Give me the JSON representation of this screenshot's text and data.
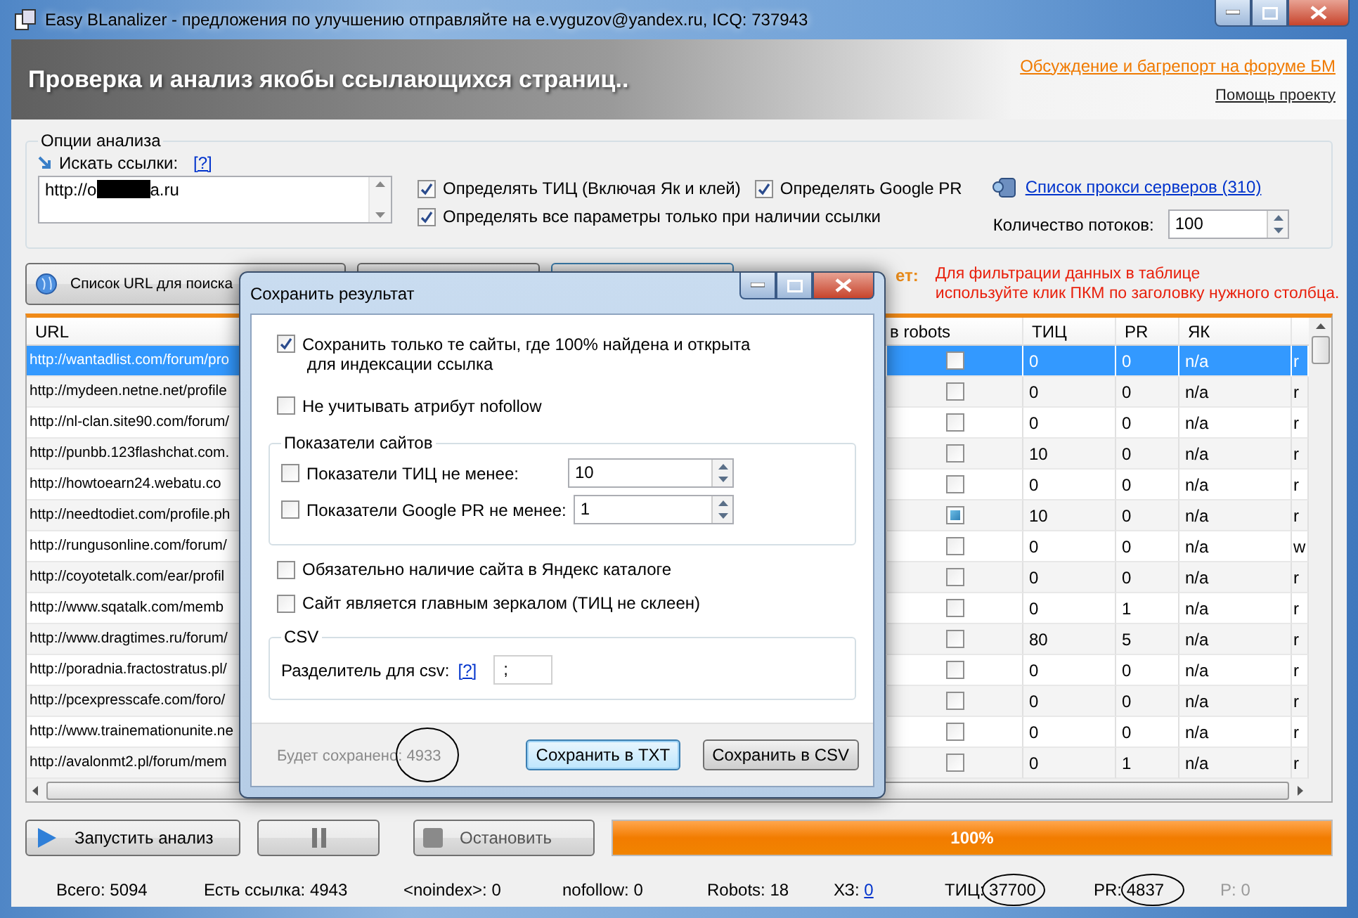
{
  "window": {
    "title": "Easy BLanalizer - предложения по улучшению отправляйте на  e.vyguzov@yandex.ru, ICQ: 737943"
  },
  "header": {
    "title": "Проверка и анализ якобы ссылающихся страниц..",
    "forum_link": "Обсуждение и багрепорт на форуме БМ",
    "help_link": "Помощь проекту"
  },
  "options": {
    "legend": "Опции анализа",
    "search_label": "Искать ссылки:",
    "help": "[?]",
    "url_field": {
      "before": "http://o",
      "after": "a.ru",
      "redacted": true
    },
    "checks": [
      {
        "label": "Определять ТИЦ (Включая Як и клей)",
        "checked": true
      },
      {
        "label": "Определять Google PR",
        "checked": true
      },
      {
        "label": "Определять все параметры только при наличии ссылки",
        "checked": true
      }
    ],
    "proxy_link": "Список прокси серверов (310)",
    "threads_label": "Количество потоков:",
    "threads_value": "100"
  },
  "toolbar": {
    "url_list_button": "Список URL для поиска",
    "partial_label": "ет:",
    "hint": "Для фильтрации данных в таблице\nиспользуйте клик ПКМ по заголовку нужного столбца."
  },
  "table": {
    "columns": [
      "URL",
      "в robots",
      "ТИЦ",
      "PR",
      "ЯК"
    ],
    "rows": [
      {
        "url": "http://wantadlist.com/forum/pro",
        "robots": false,
        "tic": "0",
        "pr": "0",
        "yk": "n/a",
        "column_6": "r",
        "selected": true
      },
      {
        "url": "http://mydeen.netne.net/profile",
        "robots": false,
        "tic": "0",
        "pr": "0",
        "yk": "n/a",
        "column_6": "r",
        "selected": false
      },
      {
        "url": "http://nl-clan.site90.com/forum/",
        "robots": false,
        "tic": "0",
        "pr": "0",
        "yk": "n/a",
        "column_6": "r",
        "selected": false
      },
      {
        "url": "http://punbb.123flashchat.com.",
        "robots": false,
        "tic": "10",
        "pr": "0",
        "yk": "n/a",
        "column_6": "r",
        "selected": false
      },
      {
        "url": "http://howtoearn24.webatu.co",
        "robots": false,
        "tic": "0",
        "pr": "0",
        "yk": "n/a",
        "column_6": "r",
        "selected": false
      },
      {
        "url": "http://needtodiet.com/profile.ph",
        "robots": true,
        "tic": "10",
        "pr": "0",
        "yk": "n/a",
        "column_6": "r",
        "selected": false
      },
      {
        "url": "http://rungusonline.com/forum/",
        "robots": false,
        "tic": "0",
        "pr": "0",
        "yk": "n/a",
        "column_6": "w",
        "selected": false
      },
      {
        "url": "http://coyotetalk.com/ear/profil",
        "robots": false,
        "tic": "0",
        "pr": "0",
        "yk": "n/a",
        "column_6": "r",
        "selected": false
      },
      {
        "url": "http://www.sqatalk.com/memb",
        "robots": false,
        "tic": "0",
        "pr": "1",
        "yk": "n/a",
        "column_6": "r",
        "selected": false
      },
      {
        "url": "http://www.dragtimes.ru/forum/",
        "robots": false,
        "tic": "80",
        "pr": "5",
        "yk": "n/a",
        "column_6": "r",
        "selected": false
      },
      {
        "url": "http://poradnia.fractostratus.pl/",
        "robots": false,
        "tic": "0",
        "pr": "0",
        "yk": "n/a",
        "column_6": "r",
        "selected": false
      },
      {
        "url": "http://pcexpresscafe.com/foro/",
        "robots": false,
        "tic": "0",
        "pr": "0",
        "yk": "n/a",
        "column_6": "r",
        "selected": false
      },
      {
        "url": "http://www.trainemationunite.ne",
        "robots": false,
        "tic": "0",
        "pr": "0",
        "yk": "n/a",
        "column_6": "r",
        "selected": false
      },
      {
        "url": "http://avalonmt2.pl/forum/mem",
        "robots": false,
        "tic": "0",
        "pr": "1",
        "yk": "n/a",
        "column_6": "r",
        "selected": false
      }
    ]
  },
  "controls": {
    "start_button": "Запустить анализ",
    "stop_button": "Остановить",
    "progress": {
      "level": 1,
      "label": "100%"
    }
  },
  "status_bar": [
    {
      "label": "Всего:",
      "value": "5094",
      "link": false,
      "disabled": false,
      "circled": false
    },
    {
      "label": "Есть ссылка:",
      "value": "4943",
      "link": false,
      "disabled": false,
      "circled": false
    },
    {
      "label": "<noindex>:",
      "value": "0",
      "link": false,
      "disabled": false,
      "circled": false
    },
    {
      "label": "nofollow:",
      "value": "0",
      "link": false,
      "disabled": false,
      "circled": false
    },
    {
      "label": "Robots:",
      "value": "18",
      "link": false,
      "disabled": false,
      "circled": false
    },
    {
      "label": "ХЗ:",
      "value": "0",
      "link": true,
      "disabled": false,
      "circled": false
    },
    {
      "label": "ТИЦ:",
      "value": "37700",
      "link": false,
      "disabled": false,
      "circled": true
    },
    {
      "label": "PR:",
      "value": "4837",
      "link": false,
      "disabled": false,
      "circled": true
    },
    {
      "label": "P:",
      "value": "0",
      "link": false,
      "disabled": true,
      "circled": false
    }
  ],
  "dialog": {
    "title": "Сохранить результат",
    "checks_top": [
      {
        "label": "Сохранить только те сайты, где 100% найдена и открыта\n для индексации ссылка",
        "checked": true
      },
      {
        "label": "Не учитывать атрибут nofollow",
        "checked": false
      }
    ],
    "metrics_group": {
      "legend": "Показатели сайтов",
      "rows": [
        {
          "label": "Показатели ТИЦ не менее:",
          "checked": false,
          "value": "10"
        },
        {
          "label": "Показатели Google PR не менее:",
          "checked": false,
          "value": "1"
        }
      ]
    },
    "checks_bottom": [
      {
        "label": "Обязательно наличие сайта в Яндекс каталоге",
        "checked": false
      },
      {
        "label": "Сайт является главным зеркалом (ТИЦ не склеен)",
        "checked": false
      }
    ],
    "csv_group": {
      "legend": "CSV",
      "label": "Разделитель для csv:",
      "help": "[?]",
      "value": ";"
    },
    "saved": {
      "text": "Будет сохранено: 4933",
      "circled": true
    },
    "buttons": [
      {
        "label": "Сохранить в TXT",
        "focused": true
      },
      {
        "label": "Сохранить в CSV",
        "focused": false
      }
    ]
  }
}
